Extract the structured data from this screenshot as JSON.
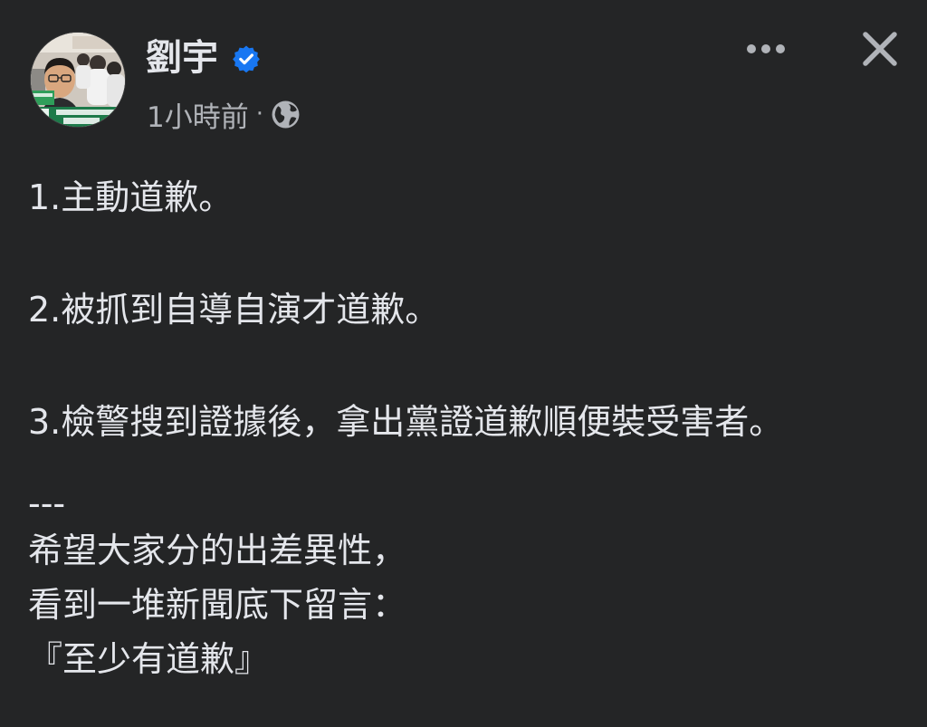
{
  "post": {
    "author": {
      "name": "劉宇",
      "verified": true,
      "avatar": "avatar-photo"
    },
    "timestamp": "1小時前",
    "separator": "·",
    "audience_icon": "globe-icon",
    "lines": {
      "item1": "1.主動道歉。",
      "item2": "2.被抓到自導自演才道歉。",
      "item3": "3.檢警搜到證據後，拿出黨證道歉順便裝受害者。",
      "divider": "---",
      "para1": "希望大家分的出差異性，",
      "para2": "看到一堆新聞底下留言：",
      "para3": "『至少有道歉』"
    }
  },
  "header_actions": {
    "more_icon": "more-dots-icon",
    "close_icon": "close-icon"
  },
  "colors": {
    "background": "#242526",
    "text": "#e4e6eb",
    "secondary_text": "#b0b3b8",
    "verified_badge": "#1877f2"
  }
}
